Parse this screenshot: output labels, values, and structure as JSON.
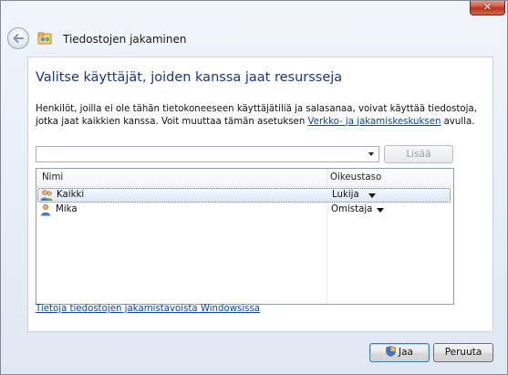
{
  "window": {
    "title": "Tiedostojen jakaminen",
    "close_glyph": "✕"
  },
  "main": {
    "heading": "Valitse käyttäjät, joiden kanssa jaat resursseja",
    "description_part1": "Henkilöt, joilla ei ole tähän tietokoneeseen käyttäjätiliä ja salasanaa, voivat käyttää tiedostoja, jotka jaat kaikkien kanssa. Voit muuttaa tämän asetuksen ",
    "description_link": "Verkko- ja jakamiskeskuksen",
    "description_part2": " avulla.",
    "combo_value": "",
    "add_button": "Lisää",
    "list": {
      "headers": {
        "name": "Nimi",
        "permission": "Oikeustaso"
      },
      "rows": [
        {
          "name": "Kaikki",
          "permission": "Lukija",
          "icon": "group-icon",
          "selected": true
        },
        {
          "name": "Mika",
          "permission": "Omistaja",
          "icon": "user-icon",
          "selected": false
        }
      ]
    },
    "footer_link": "Tietoja tiedostojen jakamistavoista Windowsissa"
  },
  "buttons": {
    "share": "Jaa",
    "cancel": "Peruuta"
  },
  "colors": {
    "heading": "#1e3287",
    "link": "#0645ad",
    "close": "#c9402a"
  }
}
